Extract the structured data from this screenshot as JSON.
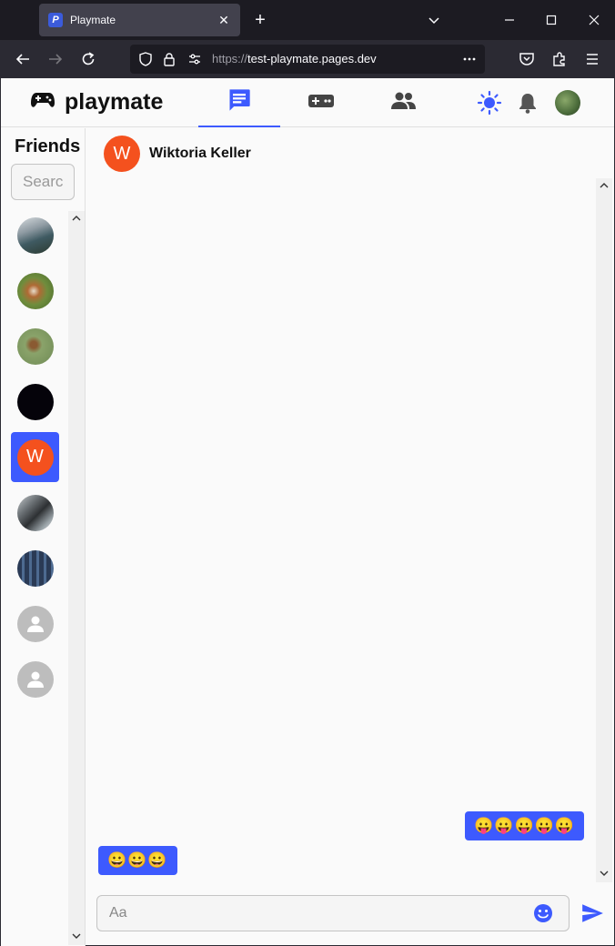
{
  "browser": {
    "tab_title": "Playmate",
    "tab_favicon_letter": "P",
    "url_scheme": "https://",
    "url_host": "test-playmate.pages.dev"
  },
  "app": {
    "brand": "playmate",
    "nav_tabs": [
      {
        "name": "chat",
        "icon": "chat-icon",
        "active": true
      },
      {
        "name": "games",
        "icon": "gamepad-icon",
        "active": false
      },
      {
        "name": "people",
        "icon": "people-icon",
        "active": false
      }
    ],
    "accent_color": "#3d5afe"
  },
  "sidebar": {
    "title": "Friends",
    "search_placeholder": "Search",
    "friends": [
      {
        "avatar": "photo",
        "selected": false
      },
      {
        "avatar": "photo",
        "selected": false
      },
      {
        "avatar": "photo",
        "selected": false
      },
      {
        "avatar": "black",
        "selected": false
      },
      {
        "avatar": "letter",
        "letter": "W",
        "selected": true
      },
      {
        "avatar": "photo",
        "selected": false
      },
      {
        "avatar": "photo",
        "selected": false
      },
      {
        "avatar": "default-person",
        "selected": false
      },
      {
        "avatar": "default-person",
        "selected": false
      }
    ]
  },
  "chat": {
    "contact_initial": "W",
    "contact_name": "Wiktoria Keller",
    "messages": [
      {
        "direction": "outgoing",
        "text": "😛😛😛😛😛"
      },
      {
        "direction": "incoming",
        "text": "😀😀😀"
      }
    ],
    "composer_placeholder": "Aa"
  }
}
